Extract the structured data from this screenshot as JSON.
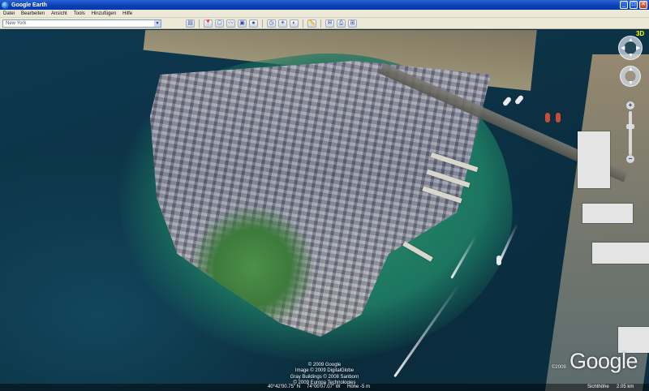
{
  "window": {
    "title": "Google Earth",
    "minimize": "_",
    "maximize": "□",
    "close": "✕"
  },
  "menu": [
    "Datei",
    "Bearbeiten",
    "Ansicht",
    "Tools",
    "Hinzufügen",
    "Hilfe"
  ],
  "search": {
    "value": "New York"
  },
  "toolbar_icons": [
    "sidebar-icon",
    "placemark-icon",
    "polygon-icon",
    "path-icon",
    "overlay-icon",
    "tour-icon",
    "historical-imagery-icon",
    "sun-icon",
    "planets-icon",
    "ruler-icon",
    "email-icon",
    "print-icon",
    "maps-icon"
  ],
  "nav": {
    "north_label": "3D"
  },
  "attribution": [
    "© 2009 Google",
    "Image © 2009 DigitalGlobe",
    "Gray Buildings © 2008 Sanborn",
    "© 2009 Europa Technologies"
  ],
  "logo": {
    "year": "©2009",
    "text": "Google"
  },
  "status": {
    "latitude": "40°42'00.75\" N",
    "longitude": "74°00'07.07\" W",
    "elevation": "Höhe -5 m",
    "eye_alt_label": "Sichthöhe",
    "eye_alt_value": "2.05 km"
  }
}
